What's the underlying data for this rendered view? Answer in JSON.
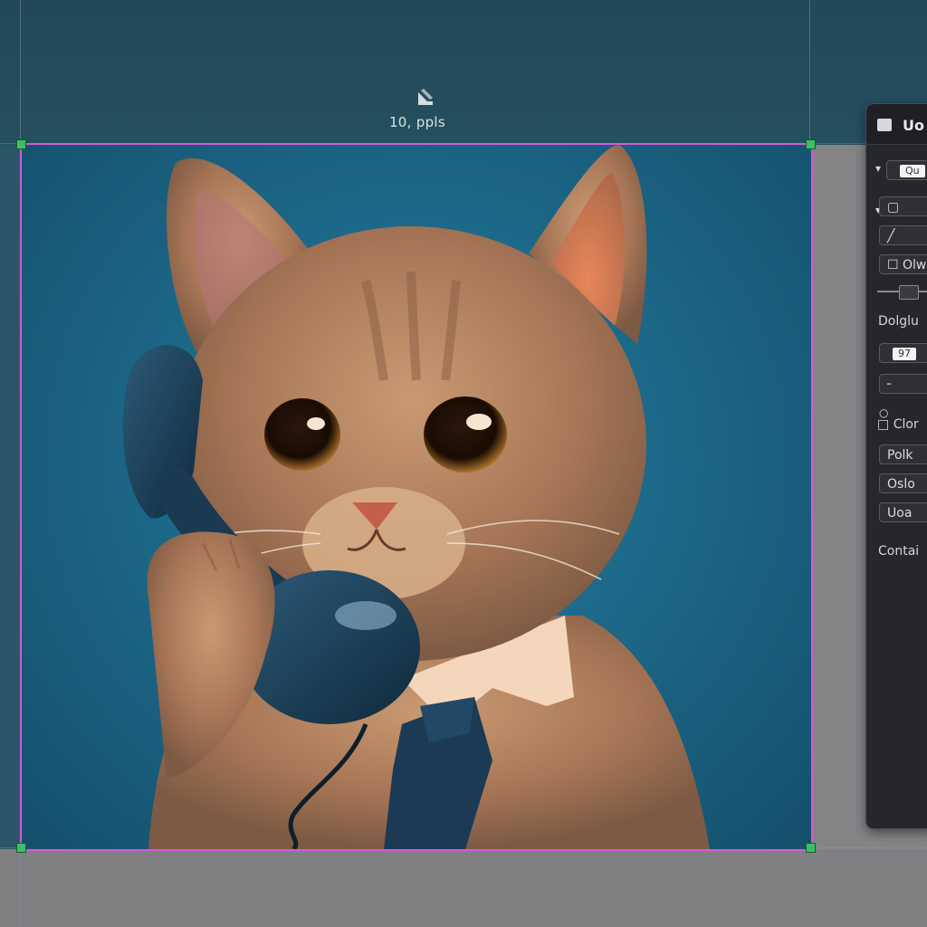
{
  "canvas": {
    "dimension_label": "10, ppls",
    "selection_color": "#d35ad9",
    "handle_color": "#3cc064"
  },
  "panel": {
    "title": "Uo",
    "rows": [
      {
        "label": "",
        "chip": "Qu"
      },
      {
        "label": "▢",
        "chip": ""
      },
      {
        "label": "╱",
        "chip": ""
      },
      {
        "label": "☐ Olwa",
        "chip": ""
      }
    ],
    "section_1": "Dolglu",
    "rows_2": [
      {
        "label": "",
        "chip": "97"
      },
      {
        "label": "╴",
        "chip": ""
      }
    ],
    "checkbox_label": "Clor",
    "buttons": [
      "Polk",
      "Oslo",
      "Uoa"
    ],
    "section_2": "Contai"
  },
  "colors": {
    "panel_bg": "#26272b",
    "backdrop_teal": "#22485a",
    "artboard_teal": "#1c6888"
  }
}
